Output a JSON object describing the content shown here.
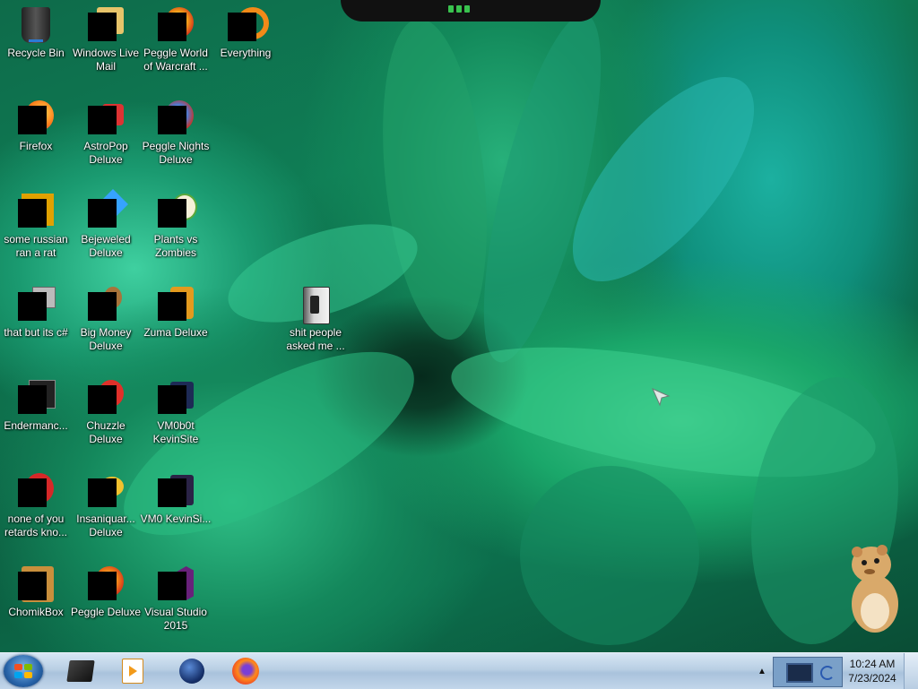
{
  "desktop_icons": [
    {
      "label": "Recycle Bin",
      "icon": "recycle-bin-icon"
    },
    {
      "label": "Windows Live Mail",
      "icon": "mail-icon"
    },
    {
      "label": "Peggle World of Warcraft ...",
      "icon": "peggle-icon"
    },
    {
      "label": "Everything",
      "icon": "search-icon"
    },
    {
      "label": "Firefox",
      "icon": "firefox-icon"
    },
    {
      "label": "AstroPop Deluxe",
      "icon": "game-icon"
    },
    {
      "label": "Peggle Nights Deluxe",
      "icon": "peggle-icon"
    },
    {
      "label": "some russian ran a rat",
      "icon": "shortcut-icon"
    },
    {
      "label": "Bejeweled Deluxe",
      "icon": "gem-icon"
    },
    {
      "label": "Plants vs Zombies",
      "icon": "plant-icon"
    },
    {
      "label": "that but its c#",
      "icon": "shortcut-icon"
    },
    {
      "label": "Big Money Deluxe",
      "icon": "money-icon"
    },
    {
      "label": "Zuma Deluxe",
      "icon": "zuma-icon"
    },
    {
      "label": "Endermanc...",
      "icon": "app-icon"
    },
    {
      "label": "Chuzzle Deluxe",
      "icon": "chuzzle-icon"
    },
    {
      "label": "VM0b0t KevinSite",
      "icon": "folder-icon"
    },
    {
      "label": "none of you retards kno...",
      "icon": "shortcut-icon"
    },
    {
      "label": "Insaniquar... Deluxe",
      "icon": "fish-icon"
    },
    {
      "label": "VM0 KevinSi...",
      "icon": "file-icon"
    },
    {
      "label": "ChomikBox",
      "icon": "chomikbox-icon"
    },
    {
      "label": "Peggle Deluxe",
      "icon": "peggle-icon"
    },
    {
      "label": "Visual Studio 2015",
      "icon": "visual-studio-icon"
    },
    {
      "label": "shit people asked me ...",
      "icon": "folder-icon"
    }
  ],
  "taskbar": {
    "start_icon": "windows-logo-icon",
    "pinned": [
      {
        "name": "tablet-app-icon"
      },
      {
        "name": "media-player-icon"
      },
      {
        "name": "globe-icon"
      },
      {
        "name": "firefox-icon"
      }
    ],
    "tray_arrow": "▲",
    "clock_time": "10:24 AM",
    "clock_date": "7/23/2024"
  },
  "colors": {
    "taskbar": "#b9cfe4",
    "wallpaper_green": "#1aa76a"
  }
}
